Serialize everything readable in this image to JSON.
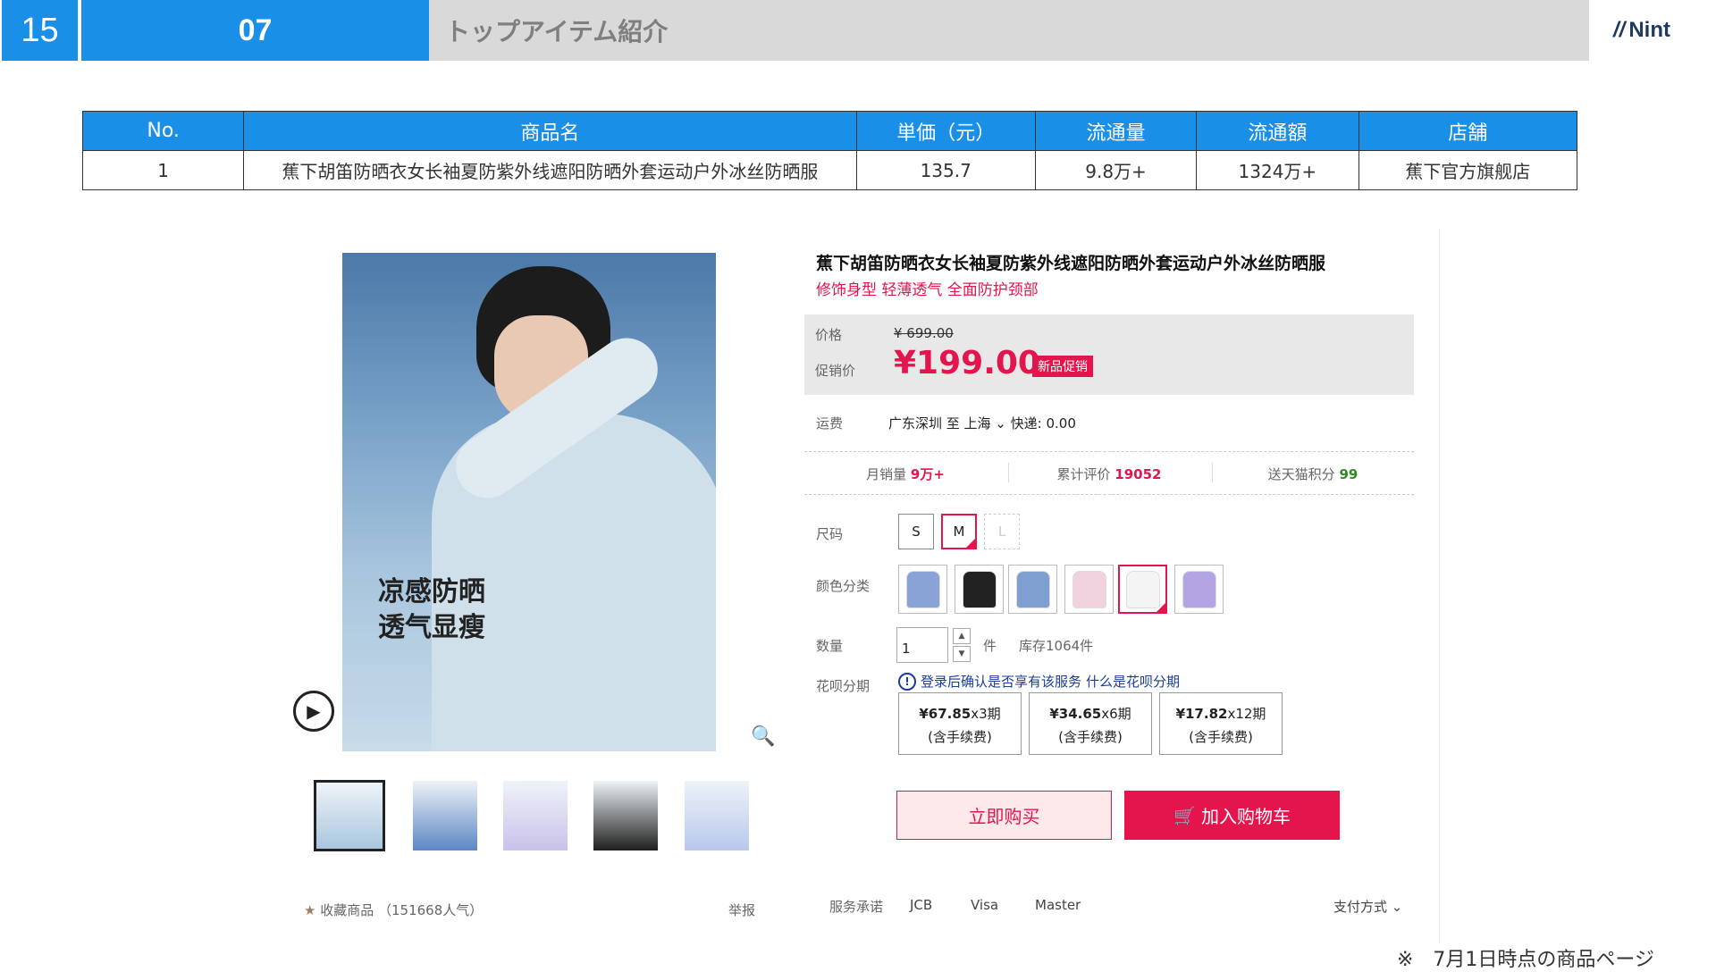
{
  "header": {
    "slide_number": "15",
    "section_number": "07",
    "title": "トップアイテム紹介",
    "logo": "Nint"
  },
  "table": {
    "headers": [
      "No.",
      "商品名",
      "単価（元）",
      "流通量",
      "流通額",
      "店舗"
    ],
    "rows": [
      [
        "1",
        "蕉下胡笛防晒衣女长袖夏防紫外线遮阳防晒外套运动户外冰丝防晒服",
        "135.7",
        "9.8万+",
        "1324万+",
        "蕉下官方旗舰店"
      ]
    ]
  },
  "product": {
    "image_caption_1": "凉感防晒",
    "image_caption_2": "透气显瘦",
    "title": "蕉下胡笛防晒衣女长袖夏防紫外线遮阳防晒外套运动户外冰丝防晒服",
    "subtitle": "修饰身型 轻薄透气 全面防护颈部",
    "price_label": "价格",
    "price_original": "¥ 699.00",
    "promo_label": "促销价",
    "price_promo": "¥199.00",
    "promo_badge": "新品促销",
    "shipping_label": "运费",
    "shipping_value": "广东深圳  至 上海 ⌄  快递: 0.00",
    "monthly_sales_label": "月销量",
    "monthly_sales_value": "9万+",
    "reviews_label": "累计评价",
    "reviews_value": "19052",
    "points_label": "送天猫积分",
    "points_value": "99",
    "size_label": "尺码",
    "sizes": [
      "S",
      "M",
      "L"
    ],
    "color_label": "颜色分类",
    "colors": [
      "#8aa3d6",
      "#222222",
      "#7f9fd0",
      "#f0d2de",
      "#f4f4f4",
      "#b3a4e4"
    ],
    "qty_label": "数量",
    "qty_value": "1",
    "qty_unit": "件",
    "stock": "库存1064件",
    "installment_label": "花呗分期",
    "installment_note": "登录后确认是否享有该服务",
    "installment_link": "什么是花呗分期",
    "installments": [
      {
        "amount": "¥67.85",
        "period": "x3期",
        "fee": "(含手续费)"
      },
      {
        "amount": "¥34.65",
        "period": "x6期",
        "fee": "(含手续费)"
      },
      {
        "amount": "¥17.82",
        "period": "x12期",
        "fee": "(含手续费)"
      }
    ],
    "buy_now": "立即购买",
    "add_cart": "加入购物车",
    "favorite": "收藏商品  （151668人气）",
    "report": "举报",
    "service_label": "服务承诺",
    "services": [
      "JCB",
      "Visa",
      "Master"
    ],
    "payment": "支付方式 ⌄"
  },
  "thumbnails": [
    "#a9c6de",
    "#5d86c4",
    "#c9c2ea",
    "#1e1e1e",
    "#b8c8ec"
  ],
  "footnote": "※　7月1日時点の商品ページ"
}
